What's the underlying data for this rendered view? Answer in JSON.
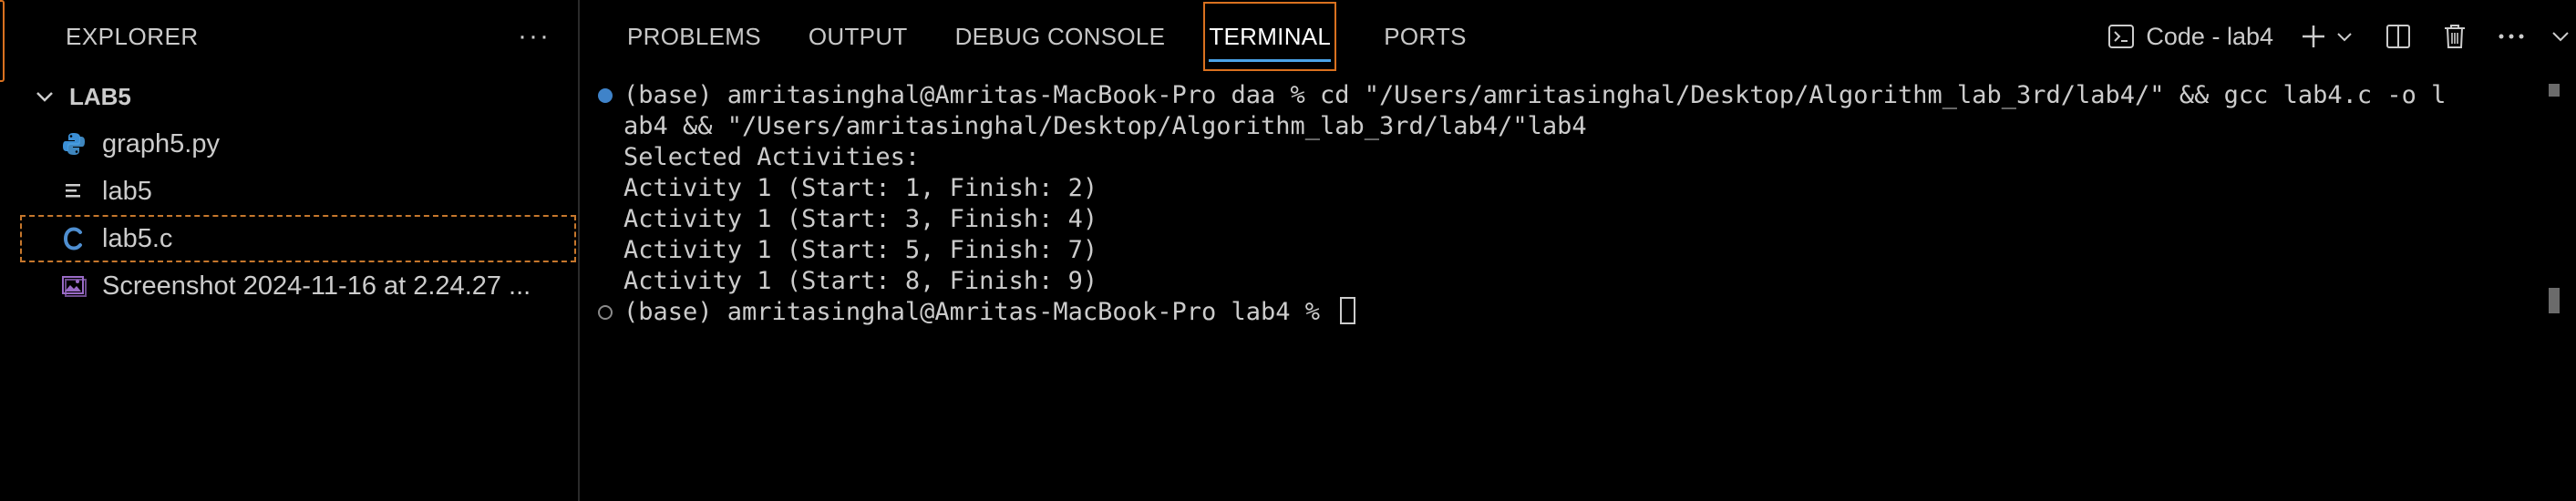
{
  "explorer": {
    "title": "EXPLORER",
    "more": "···",
    "folder": "LAB5",
    "files": [
      {
        "name": "graph5.py",
        "icon": "python-file-icon"
      },
      {
        "name": "lab5",
        "icon": "text-file-icon"
      },
      {
        "name": "lab5.c",
        "icon": "c-file-icon",
        "selected": true
      },
      {
        "name": "Screenshot 2024-11-16 at 2.24.27 ...",
        "icon": "image-file-icon"
      }
    ]
  },
  "panel": {
    "tabs": [
      "PROBLEMS",
      "OUTPUT",
      "DEBUG CONSOLE",
      "TERMINAL",
      "PORTS"
    ],
    "active_tab": "TERMINAL",
    "terminal_name": "Code - lab4"
  },
  "terminal": {
    "lines": [
      "(base) amritasinghal@Amritas-MacBook-Pro daa % cd \"/Users/amritasinghal/Desktop/Algorithm_lab_3rd/lab4/\" && gcc lab4.c -o l",
      "ab4 && \"/Users/amritasinghal/Desktop/Algorithm_lab_3rd/lab4/\"lab4",
      "Selected Activities:",
      "Activity 1 (Start: 1, Finish: 2)",
      "Activity 1 (Start: 3, Finish: 4)",
      "Activity 1 (Start: 5, Finish: 7)",
      "Activity 1 (Start: 8, Finish: 9)",
      "(base) amritasinghal@Amritas-MacBook-Pro lab4 % "
    ]
  },
  "colors": {
    "accent": "#d9711f",
    "tab_underline": "#4aa3e8",
    "prompt_dot": "#3f83c9",
    "python_icon": "#3b8fd6",
    "c_icon": "#4f8fd1"
  }
}
